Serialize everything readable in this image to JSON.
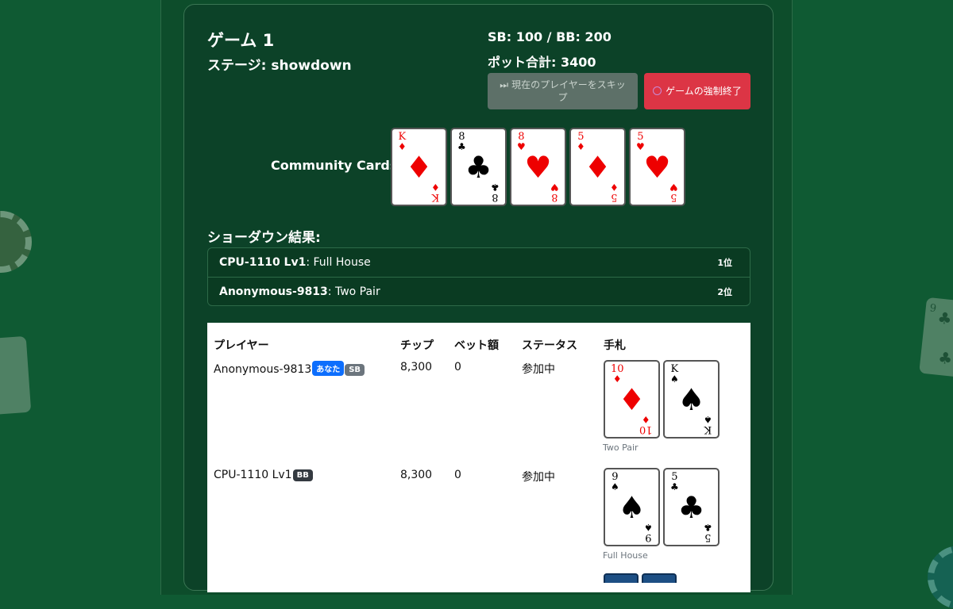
{
  "game": {
    "title": "ゲーム 1",
    "stage": "ステージ: showdown",
    "blinds": "SB: 100 / BB: 200",
    "pot": "ポット合計: 3400",
    "skip_button": "現在のプレイヤーをスキップ",
    "force_end_button": "ゲームの強制終了"
  },
  "community": {
    "label": "Community Cards:",
    "cards": [
      {
        "rank": "K",
        "suit": "♦",
        "color": "#ee0000"
      },
      {
        "rank": "8",
        "suit": "♣",
        "color": "#000000"
      },
      {
        "rank": "8",
        "suit": "♥",
        "color": "#ee0000"
      },
      {
        "rank": "5",
        "suit": "♦",
        "color": "#ee0000"
      },
      {
        "rank": "5",
        "suit": "♥",
        "color": "#ee0000"
      }
    ]
  },
  "showdown": {
    "title": "ショーダウン結果:",
    "results": [
      {
        "player": "CPU-1110 Lv1",
        "hand": ": Full House",
        "rank": "1位"
      },
      {
        "player": "Anonymous-9813",
        "hand": ": Two Pair",
        "rank": "2位"
      }
    ]
  },
  "table": {
    "headers": [
      "プレイヤー",
      "チップ",
      "ベット額",
      "ステータス",
      "手札"
    ],
    "rows": [
      {
        "name": "Anonymous-9813",
        "badges": [
          "あなた",
          "SB"
        ],
        "chips": "8,300",
        "bet": "0",
        "status": "参加中",
        "hand_name": "Two Pair",
        "cards": [
          {
            "rank": "10",
            "suit": "♦"
          },
          {
            "rank": "K",
            "suit": "♠"
          }
        ]
      },
      {
        "name": "CPU-1110 Lv1",
        "badges": [
          "BB"
        ],
        "chips": "8,300",
        "bet": "0",
        "status": "参加中",
        "hand_name": "Full House",
        "cards": [
          {
            "rank": "9",
            "suit": "♠"
          },
          {
            "rank": "5",
            "suit": "♣"
          }
        ]
      }
    ]
  },
  "colors": {
    "background": "#0f5a33",
    "panel": "#0c4228",
    "danger": "#dc3545",
    "primary": "#0d6efd",
    "secondary": "#6c757d"
  }
}
